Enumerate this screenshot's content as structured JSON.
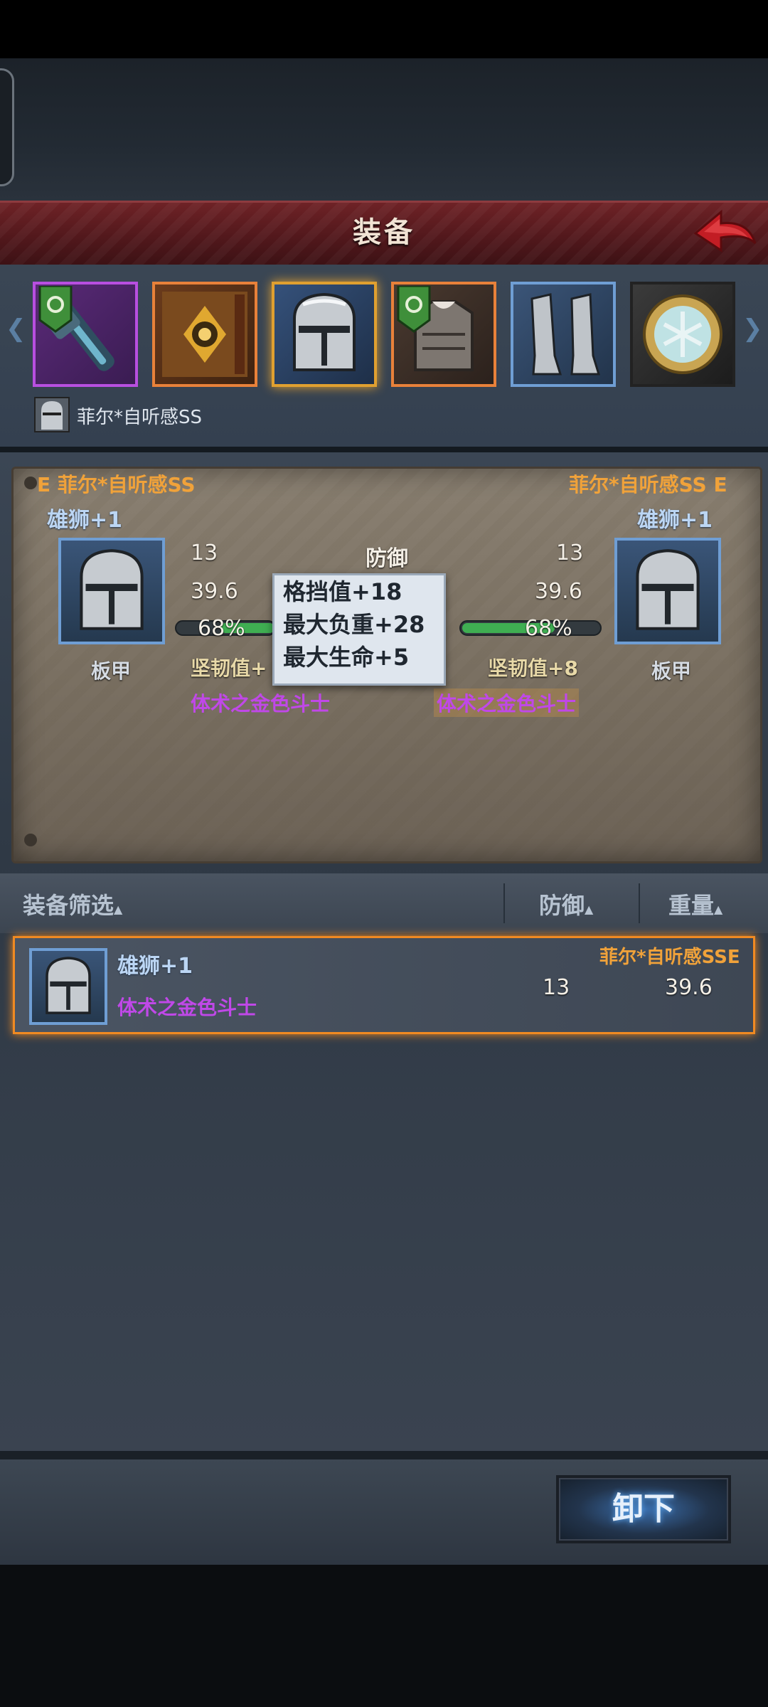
{
  "header": {
    "title": "装备"
  },
  "equipment_slots": [
    {
      "icon": "mace-icon",
      "border": "#b84fe0",
      "has_badge": true
    },
    {
      "icon": "tome-icon",
      "border": "#e8813a",
      "has_badge": false
    },
    {
      "icon": "helmet-icon",
      "border": "#e0a030",
      "has_badge": false,
      "selected": true
    },
    {
      "icon": "armor-icon",
      "border": "#e8813a",
      "has_badge": true
    },
    {
      "icon": "greaves-icon",
      "border": "#6f9ed4",
      "has_badge": false
    },
    {
      "icon": "amulet-icon",
      "border": "#222222",
      "has_badge": false
    }
  ],
  "character": {
    "name": "菲尔*自听感SS"
  },
  "compare": {
    "left": {
      "owner": "E 菲尔*自听感SS",
      "item_name": "雄狮+1",
      "defense": "13",
      "weight": "39.6",
      "durability": "68%",
      "durability_value": 0.68,
      "toughness": "坚韧值+",
      "set_name": "体术之金色斗士",
      "type": "板甲"
    },
    "right": {
      "owner": "菲尔*自听感SS E",
      "item_name": "雄狮+1",
      "defense": "13",
      "weight": "39.6",
      "durability": "68%",
      "durability_value": 0.68,
      "toughness": "坚韧值+8",
      "set_name": "体术之金色斗士",
      "type": "板甲"
    },
    "center_label": "防御"
  },
  "tooltip": {
    "lines": [
      "格挡值+18",
      "最大负重+28",
      "最大生命+5"
    ]
  },
  "filter": {
    "label": "装备筛选",
    "col_defense": "防御",
    "col_weight": "重量"
  },
  "list": [
    {
      "name": "雄狮+1",
      "set_name": "体术之金色斗士",
      "owner": "菲尔*自听感SSE",
      "defense": "13",
      "weight": "39.6"
    }
  ],
  "actions": {
    "unequip": "卸下"
  },
  "colors": {
    "accent_orange": "#f08a22",
    "gold_text": "#f0a23a",
    "purple_text": "#c048e8",
    "title_red": "#6e2226"
  }
}
